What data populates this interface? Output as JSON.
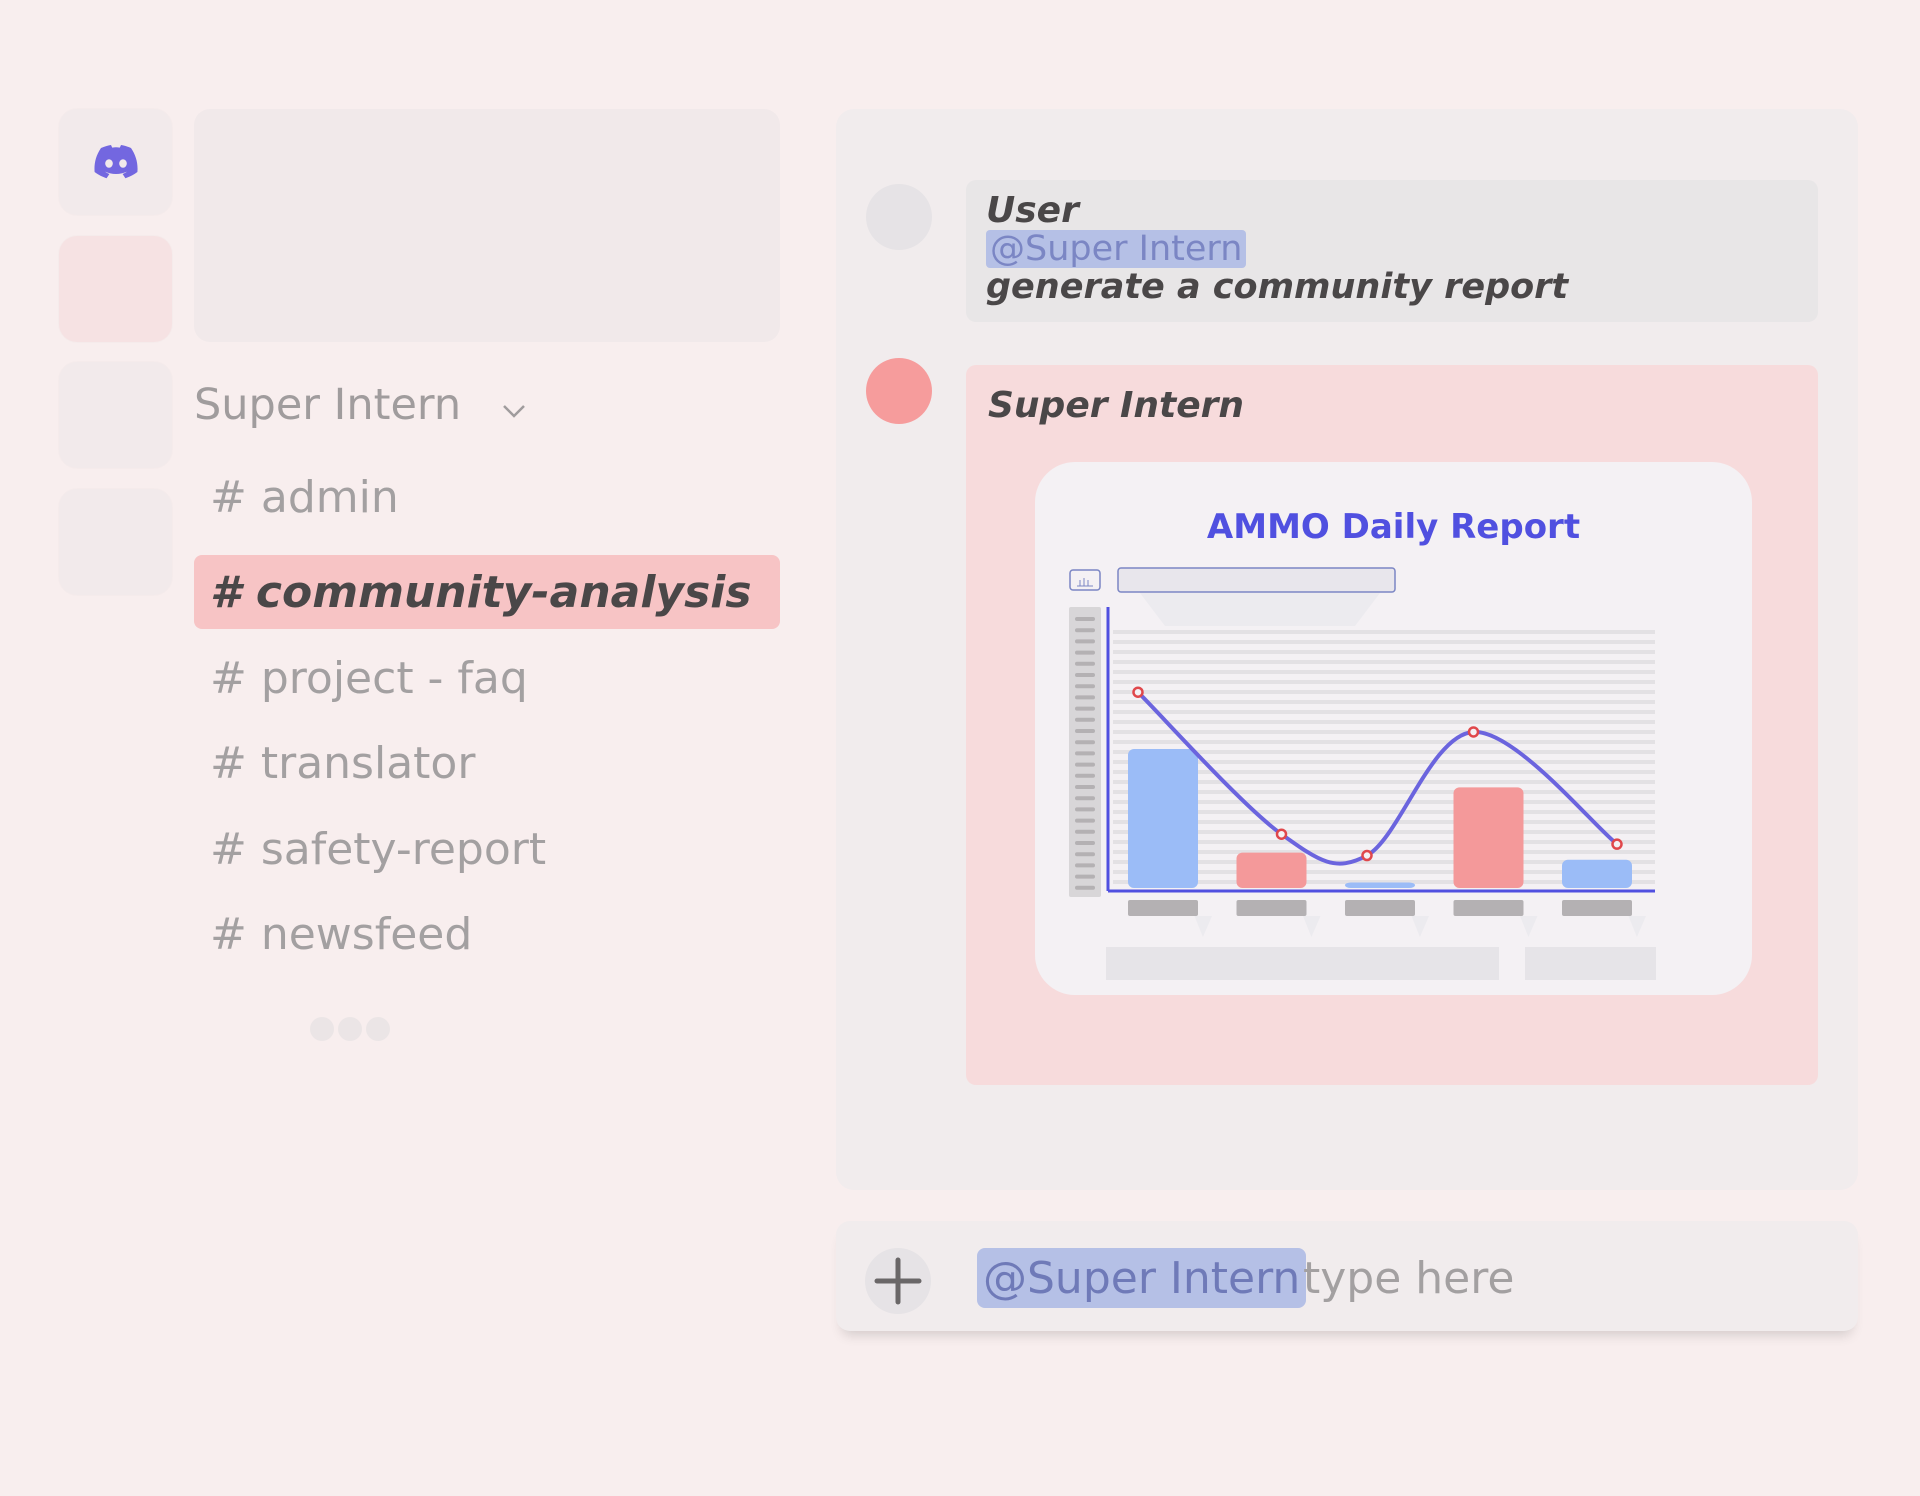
{
  "servers": [
    {
      "icon": "discord-logo-icon"
    },
    {
      "icon": "server-pink"
    },
    {
      "icon": "server-blank"
    },
    {
      "icon": "server-blank"
    }
  ],
  "sidebar": {
    "server_name": "Super Intern",
    "channels": [
      {
        "label": "# admin",
        "active": false
      },
      {
        "label": "# community-analysis",
        "active": true
      },
      {
        "label": "# project - faq",
        "active": false
      },
      {
        "label": "# translator",
        "active": false
      },
      {
        "label": "# safety-report",
        "active": false
      },
      {
        "label": "# newsfeed",
        "active": false
      }
    ]
  },
  "messages": [
    {
      "author": "User",
      "mention": "@Super Intern",
      "text": "generate a community report"
    },
    {
      "author": "Super Intern",
      "attachment_title": "AMMO Daily Report"
    }
  ],
  "composer": {
    "mention": "@Super Intern",
    "placeholder": "type here"
  },
  "colors": {
    "accent": "#5050e0",
    "active_channel_bg": "#f7c4c5",
    "bar_blue": "#9bbcf7",
    "bar_red": "#f4999a",
    "line": "#6b64de"
  },
  "chart_data": {
    "type": "bar",
    "categories": [
      "",
      "",
      "",
      "",
      ""
    ],
    "series": [
      {
        "values": [
          100,
          27,
          6,
          73,
          22
        ]
      },
      {
        "values": [
          140,
          40,
          25,
          112,
          33
        ]
      }
    ],
    "ylim": [
      0,
      200
    ],
    "grid": true
  }
}
